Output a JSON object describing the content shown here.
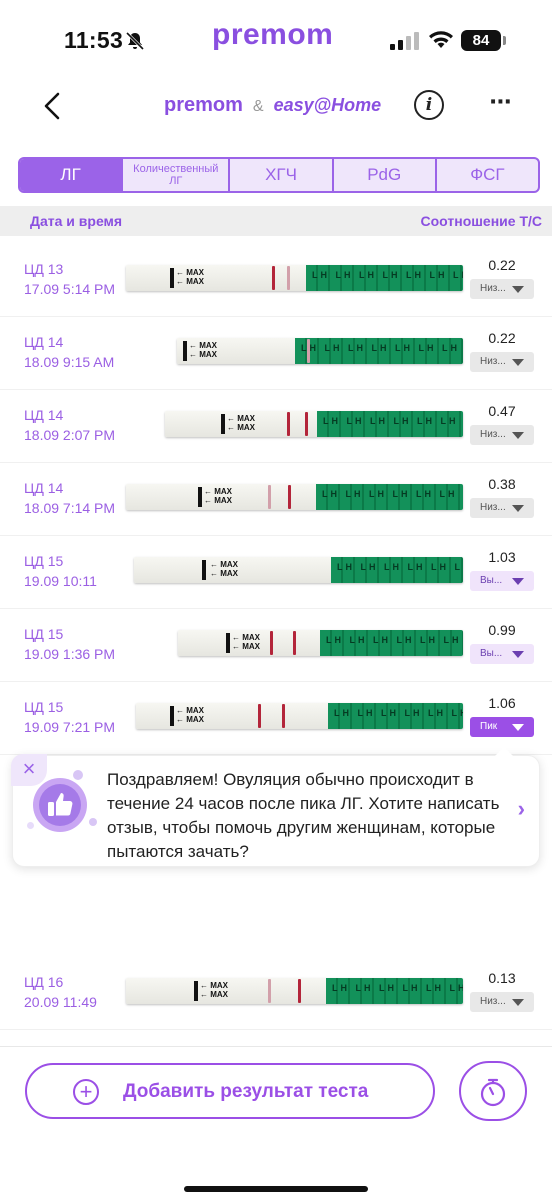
{
  "status": {
    "time": "11:53",
    "battery": "84"
  },
  "brand": {
    "top": "premom",
    "premom": "premom",
    "amp": "&",
    "easy": "easy@Home"
  },
  "tabs": [
    {
      "label": "ЛГ",
      "active": true
    },
    {
      "label": "Количественный ЛГ",
      "active": false
    },
    {
      "label": "ХГЧ",
      "active": false
    },
    {
      "label": "PdG",
      "active": false
    },
    {
      "label": "ФСГ",
      "active": false
    }
  ],
  "table": {
    "col_left": "Дата и время",
    "col_right": "Соотношение Т/С"
  },
  "rows": [
    {
      "day": "ЦД 13",
      "datetime": "17.09 5:14 PM",
      "ratio": "0.22",
      "level": "Низ...",
      "level_type": "low"
    },
    {
      "day": "ЦД 14",
      "datetime": "18.09 9:15 AM",
      "ratio": "0.22",
      "level": "Низ...",
      "level_type": "low"
    },
    {
      "day": "ЦД 14",
      "datetime": "18.09 2:07 PM",
      "ratio": "0.47",
      "level": "Низ...",
      "level_type": "low"
    },
    {
      "day": "ЦД 14",
      "datetime": "18.09 7:14 PM",
      "ratio": "0.38",
      "level": "Низ...",
      "level_type": "low"
    },
    {
      "day": "ЦД 15",
      "datetime": "19.09 10:11",
      "ratio": "1.03",
      "level": "Вы...",
      "level_type": "high"
    },
    {
      "day": "ЦД 15",
      "datetime": "19.09 1:36 PM",
      "ratio": "0.99",
      "level": "Вы...",
      "level_type": "high"
    },
    {
      "day": "ЦД 15",
      "datetime": "19.09 7:21 PM",
      "ratio": "1.06",
      "level": "Пик",
      "level_type": "peak"
    },
    {
      "day": "ЦД 16",
      "datetime": "20.09 11:49",
      "ratio": "0.13",
      "level": "Низ...",
      "level_type": "low"
    }
  ],
  "strip_text": {
    "max": "MAX",
    "lh": "LH LH LH LH LH LH LH LH LH LH LH LH LH"
  },
  "popup": {
    "close": "×",
    "text": "Поздравляем! Овуляция обычно происходит в течение 24 часов после пика ЛГ. Хотите написать отзыв, чтобы помочь другим женщинам, которые пытаются зачать?",
    "chevron": "›"
  },
  "bottom": {
    "add_label": "Добавить результат теста",
    "plus": "+"
  }
}
